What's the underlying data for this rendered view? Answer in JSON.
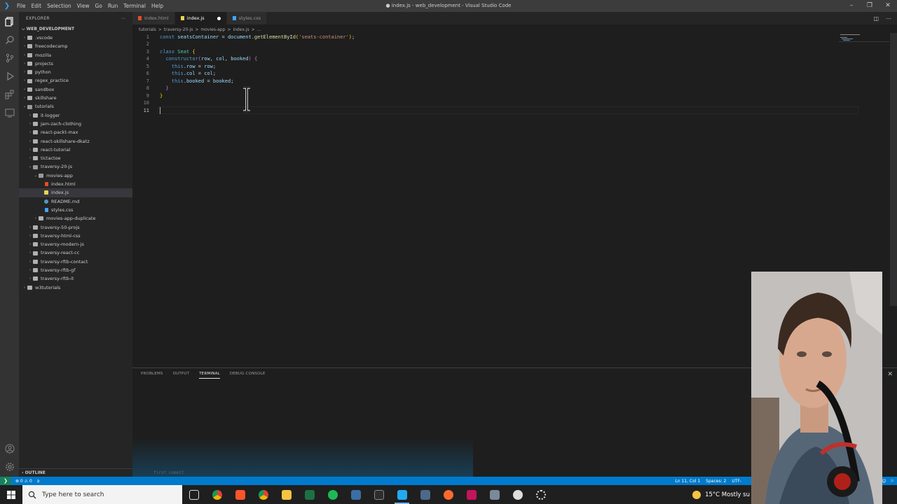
{
  "titlebar": {
    "menu": [
      "File",
      "Edit",
      "Selection",
      "View",
      "Go",
      "Run",
      "Terminal",
      "Help"
    ],
    "title": "● index.js - web_development - Visual Studio Code"
  },
  "sidebar": {
    "header": "EXPLORER",
    "root": "WEB_DEVELOPMENT",
    "items": [
      {
        "label": ".vscode",
        "type": "folder",
        "depth": 1,
        "expanded": false
      },
      {
        "label": "freecodecamp",
        "type": "folder",
        "depth": 1,
        "expanded": false
      },
      {
        "label": "mozilla",
        "type": "folder",
        "depth": 1,
        "expanded": false
      },
      {
        "label": "projects",
        "type": "folder",
        "depth": 1,
        "expanded": false
      },
      {
        "label": "python",
        "type": "folder",
        "depth": 1,
        "expanded": false
      },
      {
        "label": "regex_practice",
        "type": "folder",
        "depth": 1,
        "expanded": false
      },
      {
        "label": "sandbox",
        "type": "folder",
        "depth": 1,
        "expanded": false
      },
      {
        "label": "skillshare",
        "type": "folder",
        "depth": 1,
        "expanded": false
      },
      {
        "label": "tutorials",
        "type": "folder",
        "depth": 1,
        "expanded": true
      },
      {
        "label": "it-logger",
        "type": "folder",
        "depth": 2,
        "expanded": false
      },
      {
        "label": "jam-zach-clothing",
        "type": "folder",
        "depth": 2,
        "expanded": false
      },
      {
        "label": "react-packt-max",
        "type": "folder",
        "depth": 2,
        "expanded": false
      },
      {
        "label": "react-skillshare-dkatz",
        "type": "folder",
        "depth": 2,
        "expanded": false
      },
      {
        "label": "react-tutorial",
        "type": "folder",
        "depth": 2,
        "expanded": false
      },
      {
        "label": "tictactoe",
        "type": "folder",
        "depth": 2,
        "expanded": false
      },
      {
        "label": "traversy-20-js",
        "type": "folder",
        "depth": 2,
        "expanded": true
      },
      {
        "label": "movies-app",
        "type": "folder",
        "depth": 3,
        "expanded": true
      },
      {
        "label": "index.html",
        "type": "html",
        "depth": 4
      },
      {
        "label": "index.js",
        "type": "js",
        "depth": 4,
        "selected": true
      },
      {
        "label": "README.md",
        "type": "md",
        "depth": 4
      },
      {
        "label": "styles.css",
        "type": "css",
        "depth": 4
      },
      {
        "label": "movies-app-duplicate",
        "type": "folder",
        "depth": 3,
        "expanded": false
      },
      {
        "label": "traversy-50-projs",
        "type": "folder",
        "depth": 2,
        "expanded": false
      },
      {
        "label": "traversy-html-css",
        "type": "folder",
        "depth": 2,
        "expanded": false
      },
      {
        "label": "traversy-modern-js",
        "type": "folder",
        "depth": 2,
        "expanded": false
      },
      {
        "label": "traversy-react-cc",
        "type": "folder",
        "depth": 2,
        "expanded": false
      },
      {
        "label": "traversy-rftb-contact",
        "type": "folder",
        "depth": 2,
        "expanded": false
      },
      {
        "label": "traversy-rftb-gf",
        "type": "folder",
        "depth": 2,
        "expanded": false
      },
      {
        "label": "traversy-rftb-it",
        "type": "folder",
        "depth": 2,
        "expanded": false
      },
      {
        "label": "w3tutorials",
        "type": "folder",
        "depth": 1,
        "expanded": false
      }
    ],
    "outline": "OUTLINE"
  },
  "tabs": [
    {
      "label": "index.html",
      "type": "html",
      "active": false
    },
    {
      "label": "index.js",
      "type": "js",
      "active": true,
      "dirty": true
    },
    {
      "label": "styles.css",
      "type": "css",
      "active": false
    }
  ],
  "breadcrumb": [
    "tutorials",
    ">",
    "traversy-20-js",
    ">",
    "movies-app",
    ">",
    "index.js",
    ">",
    "..."
  ],
  "editor": {
    "lines": [
      {
        "n": "1",
        "tokens": [
          [
            "kw",
            "const "
          ],
          [
            "var",
            "seatsContainer"
          ],
          [
            "pl",
            " = "
          ],
          [
            "var",
            "document"
          ],
          [
            "pl",
            "."
          ],
          [
            "fn",
            "getElementById"
          ],
          [
            "br",
            "("
          ],
          [
            "str",
            "'seats-container'"
          ],
          [
            "br",
            ")"
          ],
          [
            "pl",
            ";"
          ]
        ]
      },
      {
        "n": "2",
        "tokens": []
      },
      {
        "n": "3",
        "tokens": [
          [
            "kwi",
            "class "
          ],
          [
            "cls",
            "Seat "
          ],
          [
            "br",
            "{"
          ]
        ]
      },
      {
        "n": "4",
        "tokens": [
          [
            "pl",
            "  "
          ],
          [
            "kw",
            "constructor"
          ],
          [
            "br2",
            "("
          ],
          [
            "var",
            "row"
          ],
          [
            "pl",
            ", "
          ],
          [
            "var",
            "col"
          ],
          [
            "pl",
            ", "
          ],
          [
            "var",
            "booked"
          ],
          [
            "br2",
            ")"
          ],
          [
            "pl",
            " "
          ],
          [
            "br2",
            "{"
          ]
        ]
      },
      {
        "n": "5",
        "tokens": [
          [
            "pl",
            "    "
          ],
          [
            "kw",
            "this"
          ],
          [
            "pl",
            "."
          ],
          [
            "var",
            "row"
          ],
          [
            "pl",
            " = "
          ],
          [
            "var",
            "row"
          ],
          [
            "pl",
            ";"
          ]
        ]
      },
      {
        "n": "6",
        "tokens": [
          [
            "pl",
            "    "
          ],
          [
            "kw",
            "this"
          ],
          [
            "pl",
            "."
          ],
          [
            "var",
            "col"
          ],
          [
            "pl",
            " = "
          ],
          [
            "var",
            "col"
          ],
          [
            "pl",
            ";"
          ]
        ]
      },
      {
        "n": "7",
        "tokens": [
          [
            "pl",
            "    "
          ],
          [
            "kw",
            "this"
          ],
          [
            "pl",
            "."
          ],
          [
            "var",
            "booked"
          ],
          [
            "pl",
            " = "
          ],
          [
            "var",
            "booked"
          ],
          [
            "pl",
            ";"
          ]
        ]
      },
      {
        "n": "8",
        "tokens": [
          [
            "pl",
            "  "
          ],
          [
            "br2",
            "}"
          ]
        ]
      },
      {
        "n": "9",
        "tokens": [
          [
            "br",
            "}"
          ]
        ]
      },
      {
        "n": "10",
        "tokens": []
      },
      {
        "n": "11",
        "tokens": [],
        "current": true
      }
    ]
  },
  "panel": {
    "tabs": [
      "PROBLEMS",
      "OUTPUT",
      "TERMINAL",
      "DEBUG CONSOLE"
    ],
    "active_tab": "TERMINAL",
    "terminal_text": "first commit"
  },
  "statusbar": {
    "errors": "⊗ 0 ⚠ 0",
    "position": "Ln 11, Col 1",
    "spaces": "Spaces: 2",
    "encoding": "UTF-"
  },
  "taskbar": {
    "search_placeholder": "Type here to search",
    "weather": "15°C  Mostly su"
  },
  "colors": {
    "accent": "#007acc",
    "remote": "#16825d",
    "editor_bg": "#1e1e1e",
    "sidebar_bg": "#252526"
  }
}
